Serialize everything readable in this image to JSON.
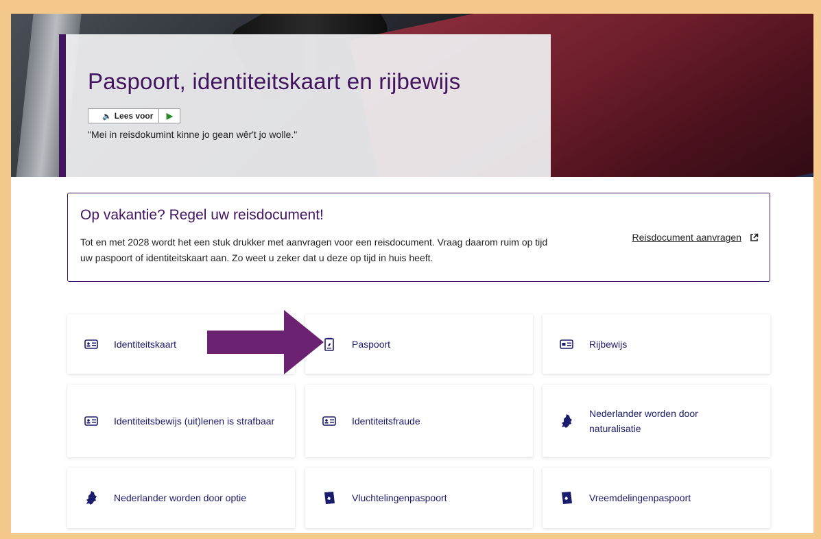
{
  "hero": {
    "title": "Paspoort, identiteitskaart en rijbewijs",
    "lees_voor": "Lees voor",
    "quote": "\"Mei in reisdokumint kinne jo gean wêr't jo wolle.\""
  },
  "notice": {
    "title": "Op vakantie? Regel uw reisdocument!",
    "text": "Tot en met 2028 wordt het een stuk drukker met aanvragen voor een reisdocument. Vraag daarom ruim op tijd uw paspoort of identiteitskaart aan. Zo weet u zeker dat u deze op tijd in huis heeft.",
    "link": "Reisdocument aanvragen"
  },
  "tiles": [
    {
      "label": "Identiteitskaart",
      "icon": "id-card-icon"
    },
    {
      "label": "Paspoort",
      "icon": "passport-icon"
    },
    {
      "label": "Rijbewijs",
      "icon": "drivers-license-icon"
    },
    {
      "label": "Identiteitsbewijs (uit)lenen is strafbaar",
      "icon": "id-card-icon"
    },
    {
      "label": "Identiteitsfraude",
      "icon": "id-card-icon"
    },
    {
      "label": "Nederlander worden door naturalisatie",
      "icon": "netherlands-map-icon"
    },
    {
      "label": "Nederlander worden door optie",
      "icon": "netherlands-map-icon"
    },
    {
      "label": "Vluchtelingenpaspoort",
      "icon": "refugee-passport-icon"
    },
    {
      "label": "Vreemdelingenpaspoort",
      "icon": "alien-passport-icon"
    }
  ],
  "colors": {
    "accent": "#42145f",
    "tile_text": "#1b1b6b",
    "arrow": "#6b2270",
    "border_frame": "#f5c88c"
  }
}
